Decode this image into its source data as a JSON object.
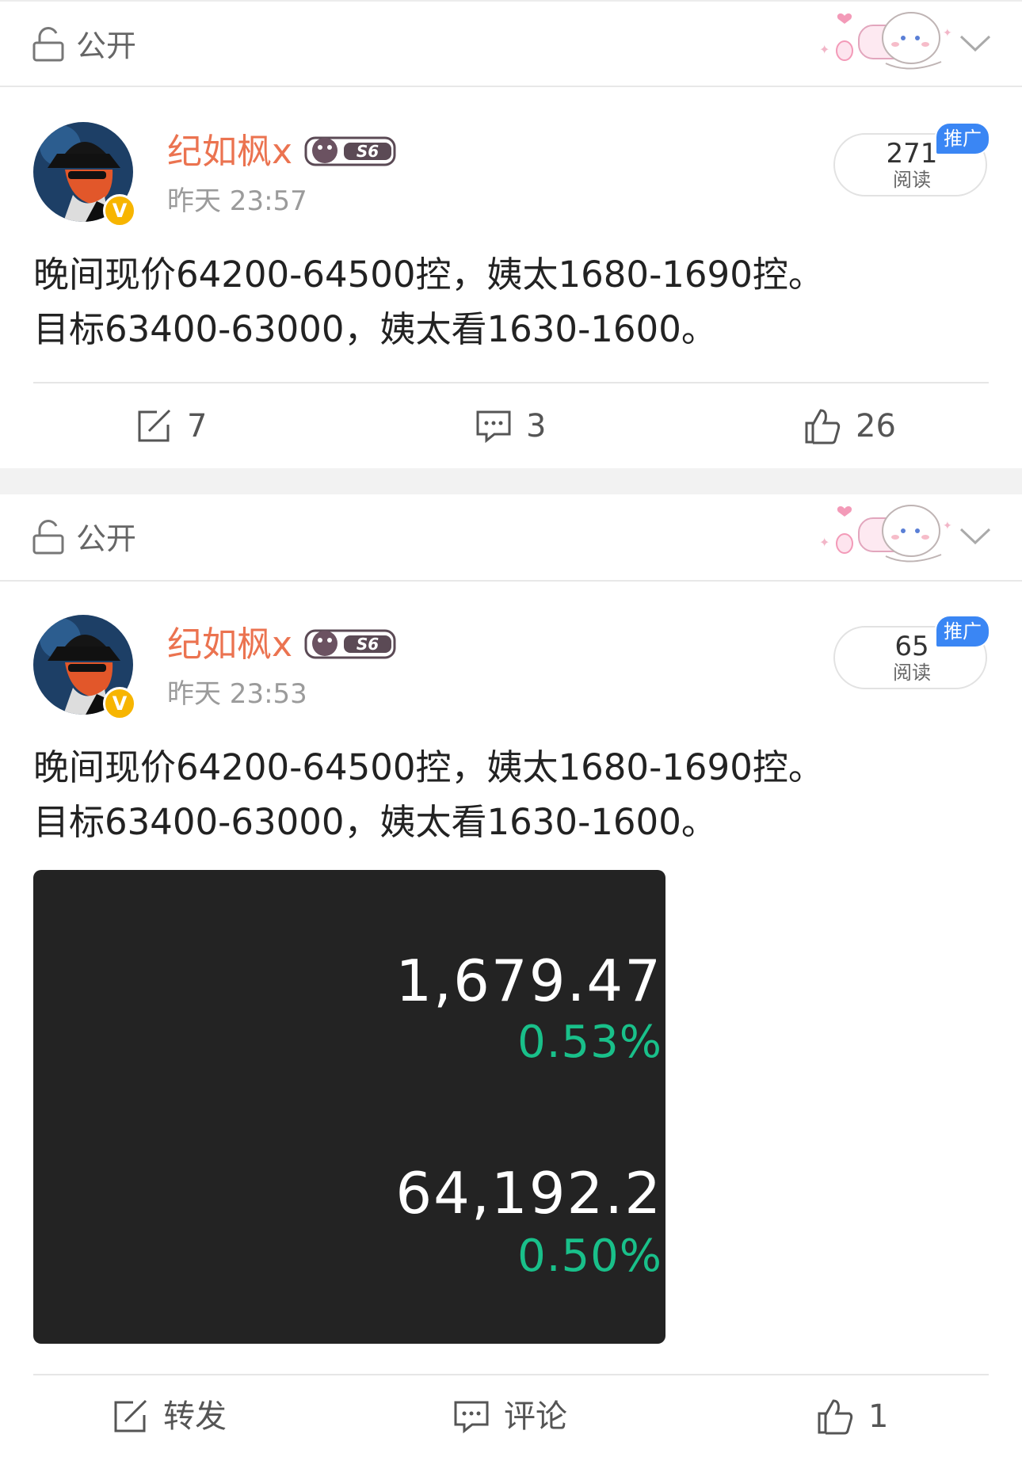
{
  "posts": [
    {
      "privacy": "公开",
      "author": "纪如枫x",
      "time": "昨天 23:57",
      "reads": {
        "count": "271",
        "label": "阅读",
        "tag": "推广"
      },
      "text": [
        "晚间现价64200-64500控，姨太1680-1690控。",
        "目标63400-63000，姨太看1630-1600。"
      ],
      "actions": {
        "repost": "7",
        "comment": "3",
        "like": "26"
      }
    },
    {
      "privacy": "公开",
      "author": "纪如枫x",
      "time": "昨天 23:53",
      "reads": {
        "count": "65",
        "label": "阅读",
        "tag": "推广"
      },
      "text": [
        "晚间现价64200-64500控，姨太1680-1690控。",
        "目标63400-63000，姨太看1630-1600。"
      ],
      "image": {
        "eth_price": "1,679.47",
        "eth_change": "0.53%",
        "btc_price": "64,192.2",
        "btc_change": "0.50%"
      },
      "actions": {
        "repost": "转发",
        "comment": "评论",
        "like": "1"
      }
    }
  ],
  "colors": {
    "username": "#eb7350",
    "promo": "#3a86f4",
    "gain": "#19c08a",
    "verified": "#f7b500"
  },
  "icons": [
    "lock-icon",
    "chevron-down-icon",
    "repost-icon",
    "comment-icon",
    "like-icon",
    "verified-icon"
  ]
}
